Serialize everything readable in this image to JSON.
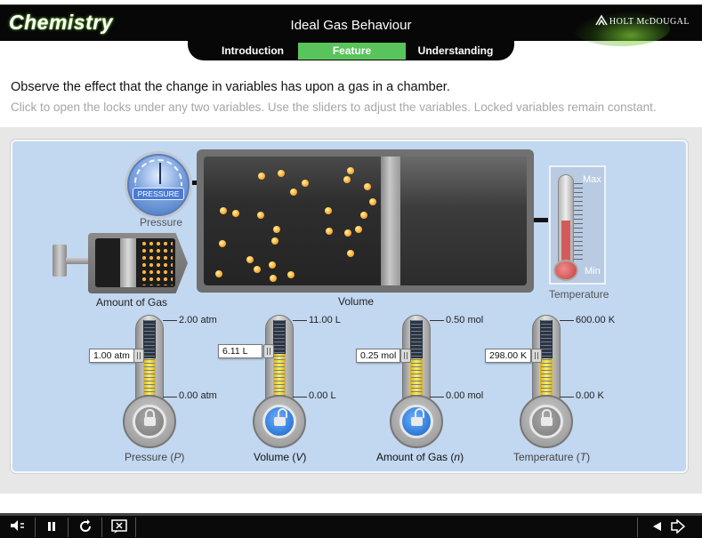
{
  "header": {
    "logo": "Chemistry",
    "title": "Ideal Gas Behaviour",
    "brand": "HOLT McDOUGAL",
    "tabs": [
      {
        "label": "Introduction",
        "active": false
      },
      {
        "label": "Feature",
        "active": true
      },
      {
        "label": "Understanding",
        "active": false
      }
    ],
    "active_tab_color": "#59c45b"
  },
  "instructions": {
    "primary": "Observe the effect that the change in variables has upon a gas in a chamber.",
    "secondary": "Click to open the locks under any two variables. Use the sliders to adjust the variables. Locked variables remain constant."
  },
  "stage": {
    "labels": {
      "pressure": "Pressure",
      "amount": "Amount of Gas",
      "volume": "Volume",
      "temperature": "Temperature"
    },
    "gauge_badge": "PRESSURE",
    "thermometer": {
      "max": "Max",
      "min": "Min"
    }
  },
  "sliders": [
    {
      "name": "Pressure",
      "symbol": "P",
      "max": "2.00 atm",
      "min": "0.00 atm",
      "value": "1.00 atm",
      "fill": 0.5,
      "locked": true
    },
    {
      "name": "Volume",
      "symbol": "V",
      "max": "11.00 L",
      "min": "0.00 L",
      "value": "6.11 L",
      "fill": 0.555,
      "locked": false
    },
    {
      "name": "Amount of Gas",
      "symbol": "n",
      "max": "0.50 mol",
      "min": "0.00 mol",
      "value": "0.25 mol",
      "fill": 0.5,
      "locked": false
    },
    {
      "name": "Temperature",
      "symbol": "T",
      "max": "600.00 K",
      "min": "0.00 K",
      "value": "298.00 K",
      "fill": 0.497,
      "locked": true
    }
  ],
  "icons": {
    "audio": "speaker-icon",
    "pause": "pause-icon",
    "replay": "replay-icon",
    "close": "close-box-icon",
    "back": "back-arrow-icon",
    "next": "next-arrow-icon"
  }
}
